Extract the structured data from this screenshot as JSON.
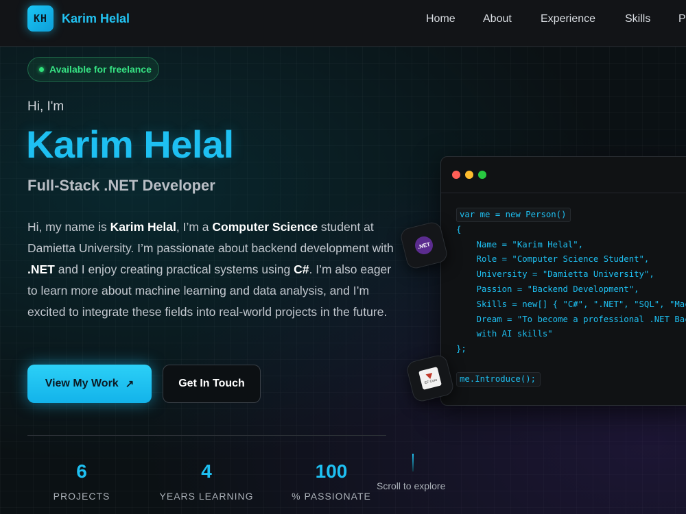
{
  "header": {
    "logo_text": "KH",
    "brand": "Karim Helal",
    "nav": [
      "Home",
      "About",
      "Experience",
      "Skills",
      "P"
    ]
  },
  "hero": {
    "badge": "Available for freelance",
    "greeting": "Hi, I'm",
    "name": "Karim Helal",
    "role": "Full-Stack .NET Developer",
    "bio": {
      "p1": "Hi, my name is ",
      "b1": "Karim Helal",
      "p2": ", I’m a ",
      "b2": "Computer Science",
      "p3": " student at Damietta University. I’m passionate about backend development with ",
      "b3": ".NET",
      "p4": " and I enjoy creating practical systems using ",
      "b4": "C#",
      "p5": ". I’m also eager to learn more about machine learning and data analysis, and I’m excited to integrate these fields into real-world projects in the future."
    },
    "primary_button": "View My Work",
    "primary_button_icon": "↗",
    "secondary_button": "Get In Touch"
  },
  "stats": [
    {
      "value": "6",
      "label": "PROJECTS"
    },
    {
      "value": "4",
      "label": "YEARS LEARNING"
    },
    {
      "value": "100",
      "label": "% PASSIONATE"
    }
  ],
  "scroll_hint": "Scroll to explore",
  "code_window": {
    "traffic_lights": [
      "#ff5f57",
      "#febc2e",
      "#28c840"
    ],
    "lines": [
      "var me = new Person()",
      "{",
      "    Name = \"Karim Helal\",",
      "    Role = \"Computer Science Student\",",
      "    University = \"Damietta University\",",
      "    Passion = \"Backend Development\",",
      "    Skills = new[] { \"C#\", \".NET\", \"SQL\", \"Mac",
      "    Dream = \"To become a professional .NET Bac",
      "    with AI skills\"",
      "};",
      "",
      "me.Introduce();"
    ]
  },
  "floating_icons": {
    "dotnet_icon_text": ".NET",
    "ef_icon_text": "EF Core"
  },
  "colors": {
    "accent": "#1ec0f2",
    "badge_green": "#36e283",
    "background": "#0a0d10"
  }
}
